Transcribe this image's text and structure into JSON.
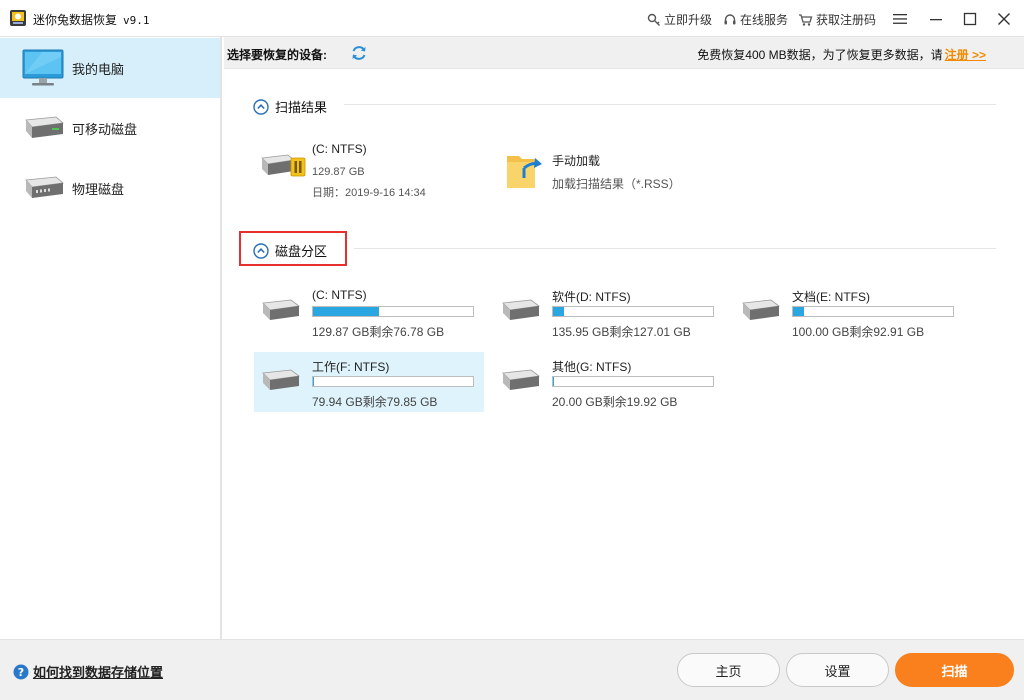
{
  "window": {
    "title": "迷你兔数据恢复",
    "version": "v9.1",
    "links": {
      "upgrade": "立即升级",
      "online_service": "在线服务",
      "get_code": "获取注册码"
    }
  },
  "sidebar": {
    "items": [
      {
        "label": "我的电脑",
        "icon": "monitor-icon",
        "active": true
      },
      {
        "label": "可移动磁盘",
        "icon": "removable-disk-icon",
        "active": false
      },
      {
        "label": "物理磁盘",
        "icon": "physical-disk-icon",
        "active": false
      }
    ]
  },
  "topbar": {
    "select_device": "选择要恢复的设备:",
    "notice_text": "免费恢复400 MB数据，为了恢复更多数据，请",
    "register_link": "注册 >>"
  },
  "scan_results": {
    "title": "扫描结果",
    "items": [
      {
        "name": "(C: NTFS)",
        "size": "129.87 GB",
        "date": "日期：2019-9-16 14:34",
        "icon": "drive-paused-icon"
      },
      {
        "name": "手动加载",
        "desc": "加载扫描结果（*.RSS）",
        "icon": "folder-load-icon"
      }
    ]
  },
  "partitions": {
    "title": "磁盘分区",
    "items": [
      {
        "name": "(C: NTFS)",
        "size": "129.87 GB剩余76.78 GB",
        "used_fraction": 0.41,
        "selected": false
      },
      {
        "name": "软件(D: NTFS)",
        "size": "135.95 GB剩余127.01 GB",
        "used_fraction": 0.066,
        "selected": false
      },
      {
        "name": "文档(E: NTFS)",
        "size": "100.00 GB剩余92.91 GB",
        "used_fraction": 0.071,
        "selected": false
      },
      {
        "name": "工作(F: NTFS)",
        "size": "79.94 GB剩余79.85 GB",
        "used_fraction": 0.001,
        "selected": true
      },
      {
        "name": "其他(G: NTFS)",
        "size": "20.00 GB剩余19.92 GB",
        "used_fraction": 0.004,
        "selected": false
      }
    ]
  },
  "footer": {
    "help_text": "如何找到数据存储位置",
    "home_button": "主页",
    "settings_button": "设置",
    "scan_button": "扫描"
  },
  "colors": {
    "accent": "#2aa6e0",
    "primary_button": "#f9801d",
    "highlight": "#e63030"
  }
}
